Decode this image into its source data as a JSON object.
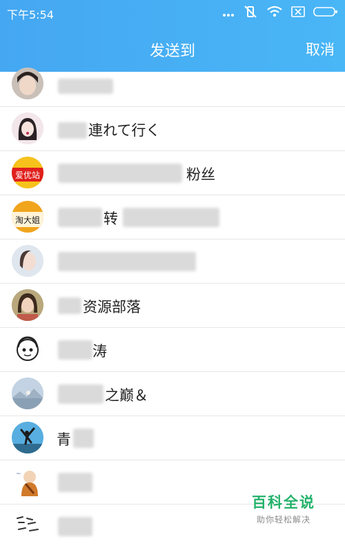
{
  "status_bar": {
    "time": "下午5:54"
  },
  "header": {
    "title": "发送到",
    "cancel_label": "取消"
  },
  "contacts": [
    {
      "name": "",
      "avatar": "girl-photo-avatar"
    },
    {
      "name": "連れて行く",
      "avatar": "illustrated-girl-avatar"
    },
    {
      "name": "粉丝",
      "avatar": "aiyouzhan-badge-avatar",
      "avatar_text": "爱优站"
    },
    {
      "name": "转",
      "avatar": "taodajie-badge-avatar",
      "avatar_text": "淘大姐"
    },
    {
      "name": "",
      "avatar": "girl-photo-avatar"
    },
    {
      "name": "资源部落",
      "avatar": "woman-photo-avatar"
    },
    {
      "name": "涛",
      "avatar": "cartoon-face-avatar"
    },
    {
      "name": "之巅＆",
      "avatar": "landscape-photo-avatar"
    },
    {
      "name": "青",
      "avatar": "jumping-person-avatar"
    },
    {
      "name": "",
      "avatar": "monk-cartoon-avatar"
    },
    {
      "name": "",
      "avatar": "handwriting-avatar"
    }
  ],
  "watermark": {
    "main": "百科全说",
    "sub": "助你轻松解决"
  }
}
